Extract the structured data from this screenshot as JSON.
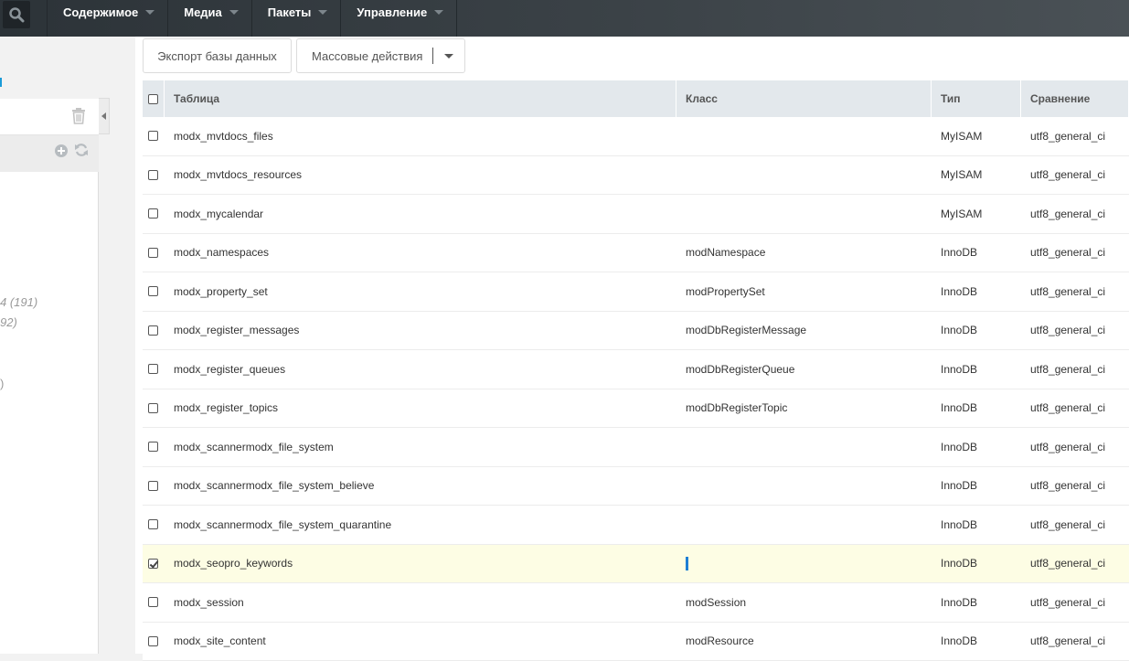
{
  "nav": {
    "items": [
      {
        "label": "Содержимое"
      },
      {
        "label": "Медиа"
      },
      {
        "label": "Пакеты"
      },
      {
        "label": "Управление"
      }
    ]
  },
  "left": {
    "counts": [
      "4 (191)",
      "92)",
      ")"
    ]
  },
  "toolbar": {
    "export_label": "Экспорт базы данных",
    "bulk_label": "Массовые действия"
  },
  "grid": {
    "headers": {
      "table": "Таблица",
      "class": "Класс",
      "type": "Тип",
      "collation": "Сравнение"
    },
    "rows": [
      {
        "table": "modx_mvtdocs_files",
        "class": "",
        "type": "MyISAM",
        "collation": "utf8_general_ci",
        "checked": false
      },
      {
        "table": "modx_mvtdocs_resources",
        "class": "",
        "type": "MyISAM",
        "collation": "utf8_general_ci",
        "checked": false
      },
      {
        "table": "modx_mycalendar",
        "class": "",
        "type": "MyISAM",
        "collation": "utf8_general_ci",
        "checked": false
      },
      {
        "table": "modx_namespaces",
        "class": "modNamespace",
        "type": "InnoDB",
        "collation": "utf8_general_ci",
        "checked": false
      },
      {
        "table": "modx_property_set",
        "class": "modPropertySet",
        "type": "InnoDB",
        "collation": "utf8_general_ci",
        "checked": false
      },
      {
        "table": "modx_register_messages",
        "class": "modDbRegisterMessage",
        "type": "InnoDB",
        "collation": "utf8_general_ci",
        "checked": false
      },
      {
        "table": "modx_register_queues",
        "class": "modDbRegisterQueue",
        "type": "InnoDB",
        "collation": "utf8_general_ci",
        "checked": false
      },
      {
        "table": "modx_register_topics",
        "class": "modDbRegisterTopic",
        "type": "InnoDB",
        "collation": "utf8_general_ci",
        "checked": false
      },
      {
        "table": "modx_scannermodx_file_system",
        "class": "",
        "type": "InnoDB",
        "collation": "utf8_general_ci",
        "checked": false
      },
      {
        "table": "modx_scannermodx_file_system_believe",
        "class": "",
        "type": "InnoDB",
        "collation": "utf8_general_ci",
        "checked": false
      },
      {
        "table": "modx_scannermodx_file_system_quarantine",
        "class": "",
        "type": "InnoDB",
        "collation": "utf8_general_ci",
        "checked": false
      },
      {
        "table": "modx_seopro_keywords",
        "class": "",
        "type": "InnoDB",
        "collation": "utf8_general_ci",
        "checked": true
      },
      {
        "table": "modx_session",
        "class": "modSession",
        "type": "InnoDB",
        "collation": "utf8_general_ci",
        "checked": false
      },
      {
        "table": "modx_site_content",
        "class": "modResource",
        "type": "InnoDB",
        "collation": "utf8_general_ci",
        "checked": false
      }
    ]
  }
}
